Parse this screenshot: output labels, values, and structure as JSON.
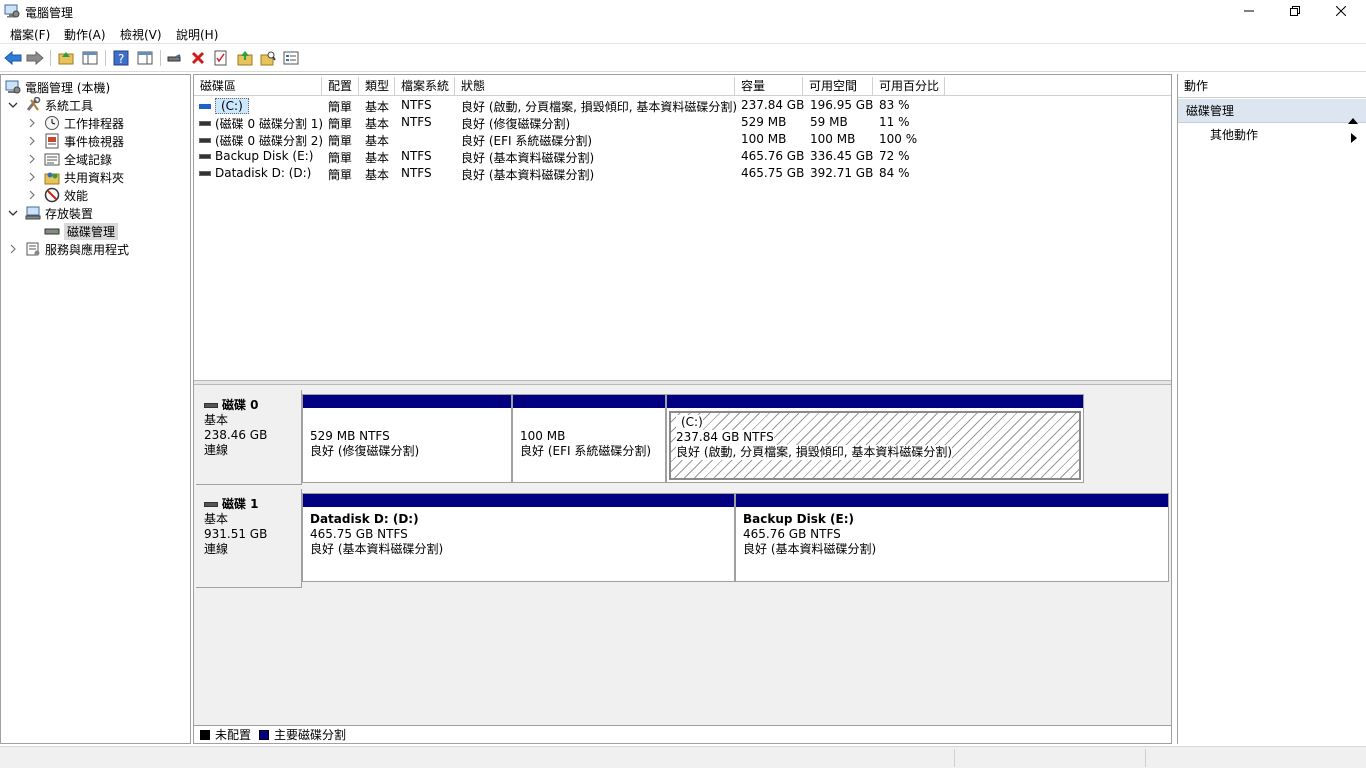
{
  "window": {
    "title": "電腦管理"
  },
  "menu": [
    "檔案(F)",
    "動作(A)",
    "檢視(V)",
    "說明(H)"
  ],
  "tree": {
    "items": [
      {
        "label": "電腦管理 (本機)",
        "icon": "computer-management-icon",
        "level": 0,
        "expanded": true
      },
      {
        "label": "系統工具",
        "icon": "tools-icon",
        "level": 1,
        "expanded": true
      },
      {
        "label": "工作排程器",
        "icon": "clock-icon",
        "level": 2,
        "expanded": false
      },
      {
        "label": "事件檢視器",
        "icon": "event-viewer-icon",
        "level": 2,
        "expanded": false
      },
      {
        "label": "全域記錄",
        "icon": "shared-folders-icon",
        "level": 2,
        "expanded": false
      },
      {
        "label": "共用資料夾",
        "icon": "users-icon",
        "level": 2,
        "expanded": false
      },
      {
        "label": "效能",
        "icon": "performance-icon",
        "level": 2,
        "expanded": false
      },
      {
        "label": "存放裝置",
        "icon": "storage-icon",
        "level": 1,
        "expanded": true
      },
      {
        "label": "磁碟管理",
        "icon": "disk-icon",
        "level": 2,
        "selected": true
      },
      {
        "label": "服務與應用程式",
        "icon": "services-icon",
        "level": 1,
        "expanded": false
      }
    ]
  },
  "volumes": {
    "columns": [
      "磁碟區",
      "配置",
      "類型",
      "檔案系統",
      "狀態",
      "容量",
      "可用空間",
      "可用百分比"
    ],
    "rows": [
      {
        "name": "(C:)",
        "layout": "簡單",
        "type": "基本",
        "fs": "NTFS",
        "status": "良好 (啟動, 分頁檔案, 損毀傾印, 基本資料磁碟分割)",
        "capacity": "237.84 GB",
        "free": "196.95 GB",
        "pct": "83 %"
      },
      {
        "name": "(磁碟 0 磁碟分割 1)",
        "layout": "簡單",
        "type": "基本",
        "fs": "NTFS",
        "status": "良好 (修復磁碟分割)",
        "capacity": "529 MB",
        "free": "59 MB",
        "pct": "11 %"
      },
      {
        "name": "(磁碟 0 磁碟分割 2)",
        "layout": "簡單",
        "type": "基本",
        "fs": "",
        "status": "良好 (EFI 系統磁碟分割)",
        "capacity": "100 MB",
        "free": "100 MB",
        "pct": "100 %"
      },
      {
        "name": "Backup Disk  (E:)",
        "layout": "簡單",
        "type": "基本",
        "fs": "NTFS",
        "status": "良好 (基本資料磁碟分割)",
        "capacity": "465.76 GB",
        "free": "336.45 GB",
        "pct": "72 %"
      },
      {
        "name": "Datadisk D:  (D:)",
        "layout": "簡單",
        "type": "基本",
        "fs": "NTFS",
        "status": "良好 (基本資料磁碟分割)",
        "capacity": "465.75 GB",
        "free": "392.71 GB",
        "pct": "84 %"
      }
    ]
  },
  "disks": [
    {
      "title": "磁碟 0",
      "kind": "基本",
      "size": "238.46 GB",
      "state": "連線",
      "partitions": [
        {
          "name": "",
          "size": "529 MB NTFS",
          "status": "良好 (修復磁碟分割)"
        },
        {
          "name": "",
          "size": "100 MB",
          "status": "良好 (EFI 系統磁碟分割)"
        },
        {
          "name": "(C:)",
          "size": "237.84 GB NTFS",
          "status": "良好 (啟動, 分頁檔案, 損毀傾印, 基本資料磁碟分割)"
        }
      ]
    },
    {
      "title": "磁碟 1",
      "kind": "基本",
      "size": "931.51 GB",
      "state": "連線",
      "partitions": [
        {
          "name": "Datadisk D:  (D:)",
          "size": "465.75 GB NTFS",
          "status": "良好 (基本資料磁碟分割)"
        },
        {
          "name": "Backup Disk  (E:)",
          "size": "465.76 GB NTFS",
          "status": "良好 (基本資料磁碟分割)"
        }
      ]
    }
  ],
  "legend": [
    {
      "label": "未配置",
      "color": "#000000"
    },
    {
      "label": "主要磁碟分割",
      "color": "#000080"
    }
  ],
  "actions": {
    "header": "動作",
    "section": "磁碟管理",
    "item": "其他動作"
  },
  "colors": {
    "partition_bar": "#000080",
    "selection": "#cce8ff",
    "actions_section": "#dde6f0"
  }
}
